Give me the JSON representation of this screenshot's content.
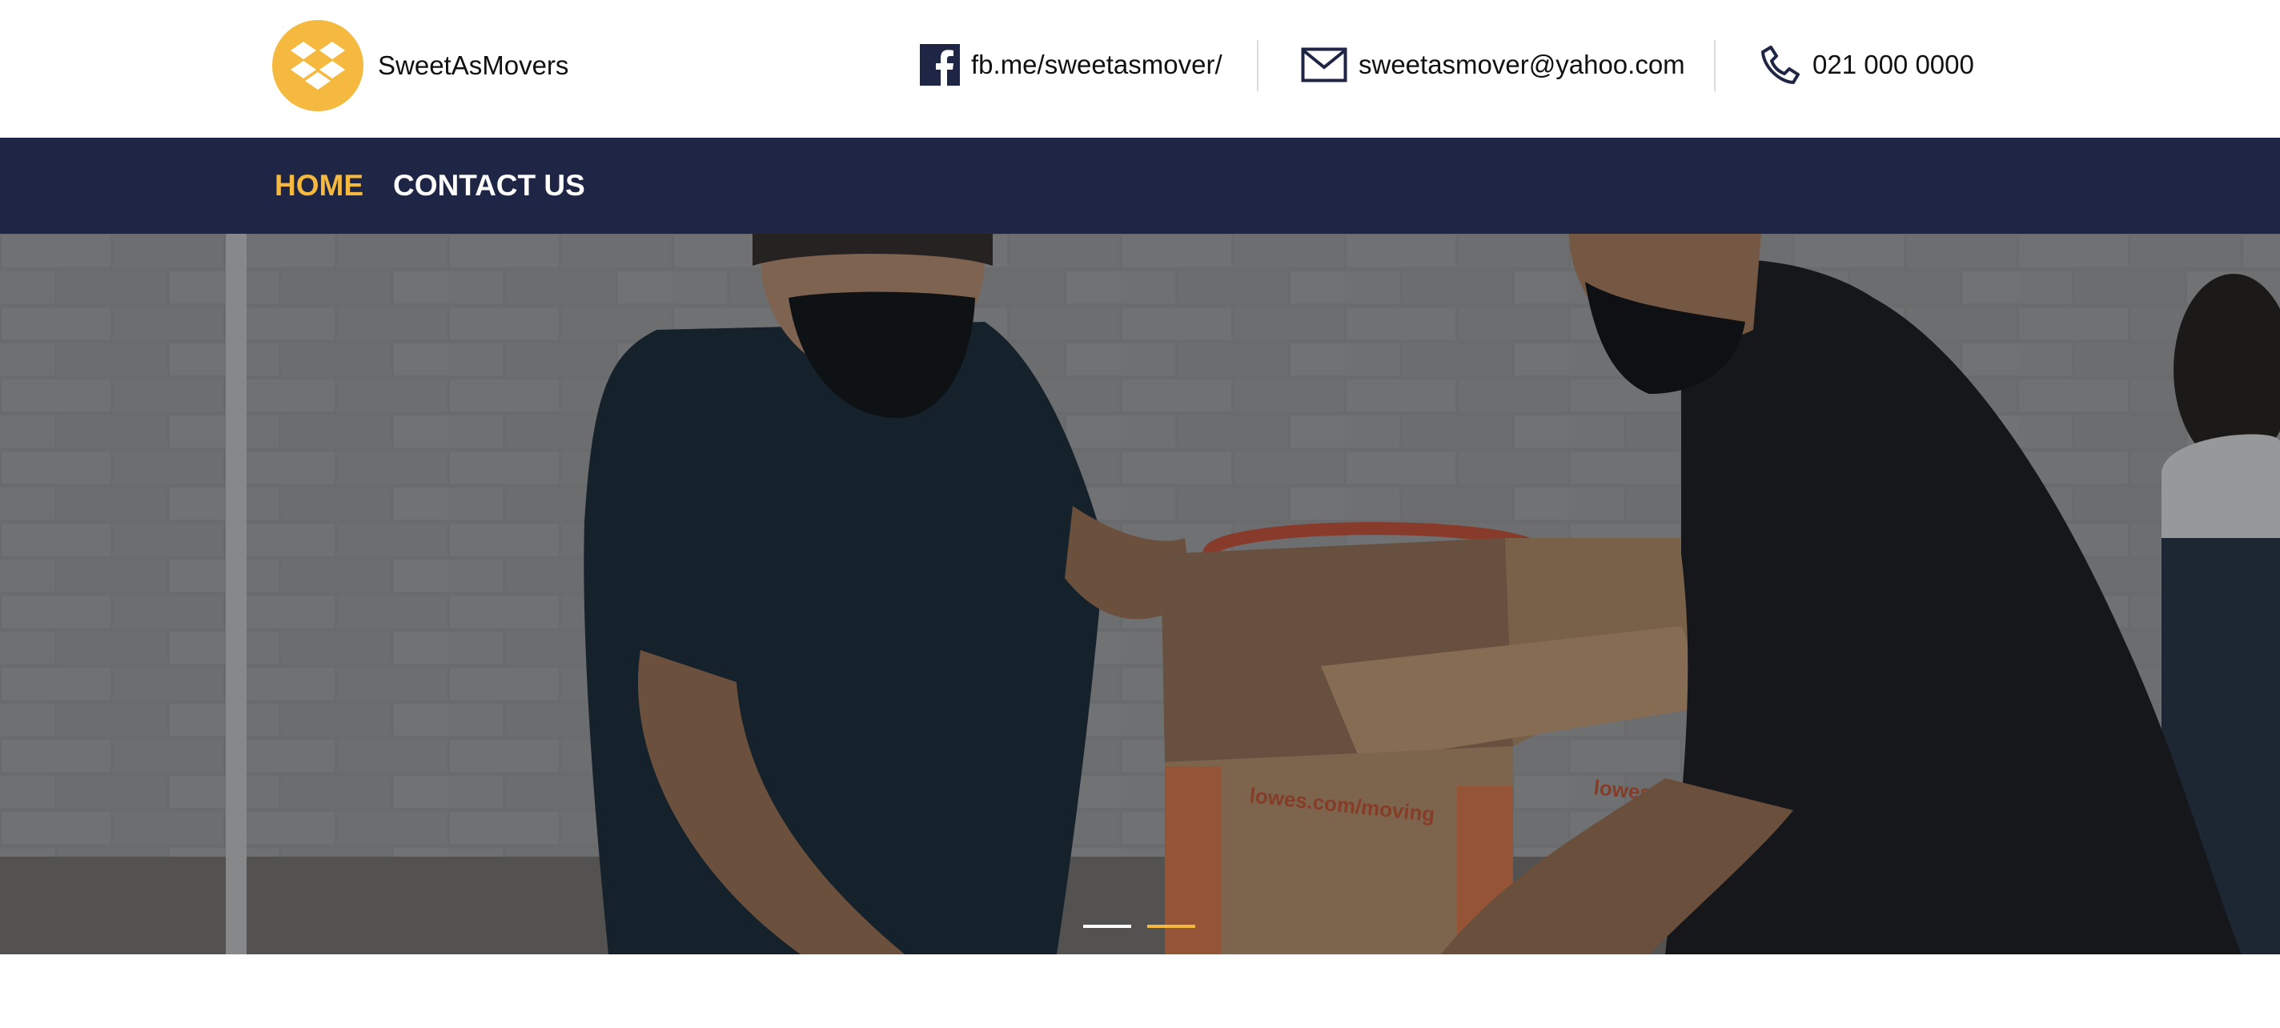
{
  "brand": {
    "name": "SweetAsMovers",
    "logo_icon": "dropbox-box-icon",
    "logo_color": "#f5b93f"
  },
  "contacts": {
    "facebook": {
      "icon": "facebook-icon",
      "text": "fb.me/sweetasmover/"
    },
    "email": {
      "icon": "mail-icon",
      "text": "sweetasmover@yahoo.com"
    },
    "phone": {
      "icon": "phone-icon",
      "text": "021 000 0000"
    }
  },
  "nav": {
    "items": [
      {
        "label": "HOME",
        "active": true
      },
      {
        "label": "CONTACT US",
        "active": false
      }
    ],
    "background": "#1f2645",
    "active_color": "#f5b93f",
    "text_color": "#ffffff"
  },
  "hero": {
    "image": "movers-wearing-masks-carrying-cardboard-box",
    "box_print": {
      "left": "lowes.com/moving",
      "right": "lowes.com"
    },
    "slides": [
      {
        "active": false
      },
      {
        "active": true
      }
    ]
  }
}
